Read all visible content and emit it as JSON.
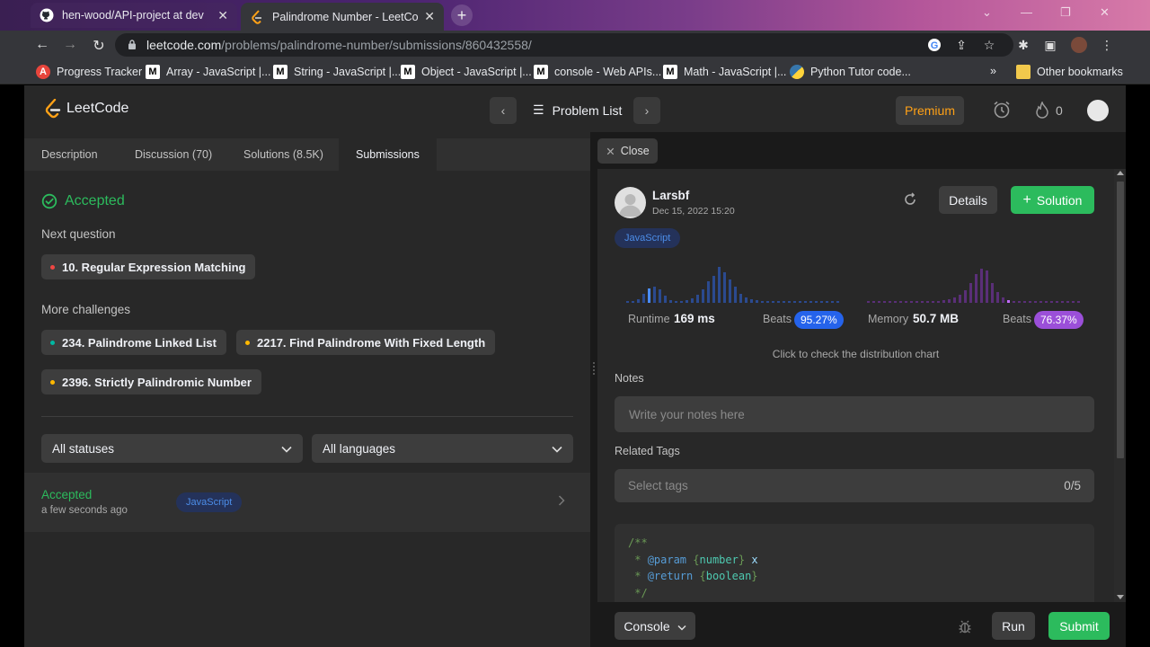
{
  "browser": {
    "tabs": [
      {
        "title": "hen-wood/API-project at dev",
        "icon": "github-icon"
      },
      {
        "title": "Palindrome Number - LeetCode",
        "icon": "leetcode-icon"
      }
    ],
    "url_domain": "leetcode.com",
    "url_path": "/problems/palindrome-number/submissions/860432558/",
    "bookmarks": [
      {
        "label": "Progress Tracker",
        "icon": "a-icon",
        "color": "#e8453c"
      },
      {
        "label": "Array - JavaScript |...",
        "icon": "mdn-icon"
      },
      {
        "label": "String - JavaScript |...",
        "icon": "mdn-icon"
      },
      {
        "label": "Object - JavaScript |...",
        "icon": "mdn-icon"
      },
      {
        "label": "console - Web APIs...",
        "icon": "mdn-icon"
      },
      {
        "label": "Math - JavaScript |...",
        "icon": "mdn-icon"
      },
      {
        "label": "Python Tutor code...",
        "icon": "python-icon"
      }
    ],
    "more_bookmarks": "»",
    "other_bookmarks": "Other bookmarks"
  },
  "nav": {
    "logo": "LeetCode",
    "problem_list": "Problem List",
    "premium": "Premium",
    "streak": "0"
  },
  "left": {
    "tabs": [
      "Description",
      "Discussion (70)",
      "Solutions (8.5K)",
      "Submissions"
    ],
    "status": "Accepted",
    "next_question_label": "Next question",
    "next_question": {
      "title": "10. Regular Expression Matching",
      "dot_color": "#ef4743"
    },
    "more_challenges_label": "More challenges",
    "challenges": [
      {
        "title": "234. Palindrome Linked List",
        "dot_color": "#00b8a3"
      },
      {
        "title": "2217. Find Palindrome With Fixed Length",
        "dot_color": "#ffb800"
      },
      {
        "title": "2396. Strictly Palindromic Number",
        "dot_color": "#ffb800"
      }
    ],
    "filter_status": "All statuses",
    "filter_language": "All languages",
    "submission": {
      "status": "Accepted",
      "time": "a few seconds ago",
      "language": "JavaScript"
    }
  },
  "right": {
    "close": "Close",
    "user": "Larsbf",
    "date": "Dec 15, 2022 15:20",
    "details": "Details",
    "solution": "Solution",
    "language": "JavaScript",
    "runtime_label": "Runtime",
    "runtime_value": "169 ms",
    "runtime_beats_label": "Beats",
    "runtime_beats": "95.27%",
    "memory_label": "Memory",
    "memory_value": "50.7 MB",
    "memory_beats_label": "Beats",
    "memory_beats": "76.37%",
    "dist_hint": "Click to check the distribution chart",
    "notes_label": "Notes",
    "notes_placeholder": "Write your notes here",
    "tags_label": "Related Tags",
    "tags_placeholder": "Select tags",
    "tags_count": "0/5",
    "code": {
      "l1": "/**",
      "l2a": " * ",
      "l2b": "@param",
      "l2c": " {",
      "l2d": "number",
      "l2e": "} ",
      "l2f": "x",
      "l3a": " * ",
      "l3b": "@return",
      "l3c": " {",
      "l3d": "boolean",
      "l3e": "}",
      "l4": " */"
    },
    "console": "Console",
    "run": "Run",
    "submit": "Submit"
  },
  "colors": {
    "accent_green": "#2cbb5d",
    "premium_orange": "#ffa116",
    "runtime_blue": "#3b82f6",
    "memory_purple": "#a855f7"
  }
}
